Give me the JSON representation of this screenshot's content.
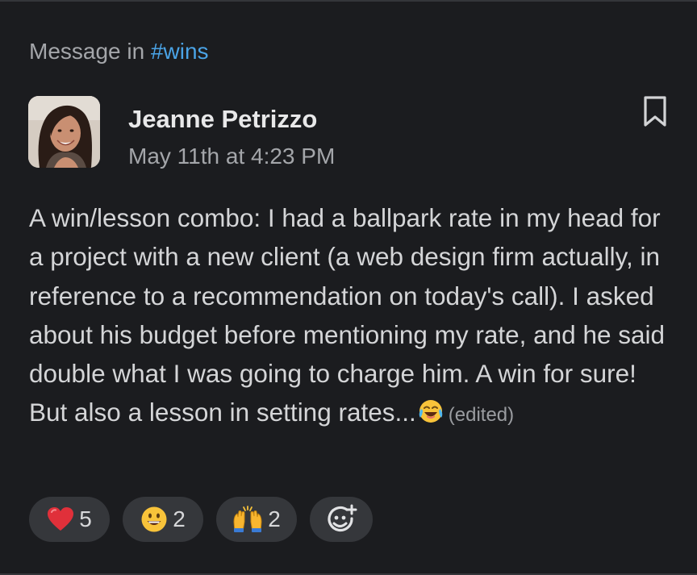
{
  "context": {
    "prefix": "Message in",
    "channel": "#wins"
  },
  "message": {
    "author": "Jeanne Petrizzo",
    "timestamp": "May 11th at 4:23 PM",
    "text": "A win/lesson combo: I had a ballpark rate in my head for a project with a new client (a web design firm actually, in reference to a recommendation on today's call). I asked about his budget before mentioning my rate, and he said double what I was going to charge him. A win for sure! But also a lesson in setting rates...",
    "inline_emoji": "face-with-tears-of-joy-icon",
    "edited_label": "(edited)"
  },
  "reactions": [
    {
      "icon": "red-heart-icon",
      "count": "5"
    },
    {
      "icon": "smiley-face-icon",
      "count": "2"
    },
    {
      "icon": "raising-hands-icon",
      "count": "2"
    }
  ],
  "add_reaction": {
    "icon": "add-reaction-icon"
  },
  "colors": {
    "background": "#1b1c1f",
    "channel_link": "#4aa3e6",
    "pill_background": "#35373b",
    "muted_text": "#a4a6aa"
  }
}
